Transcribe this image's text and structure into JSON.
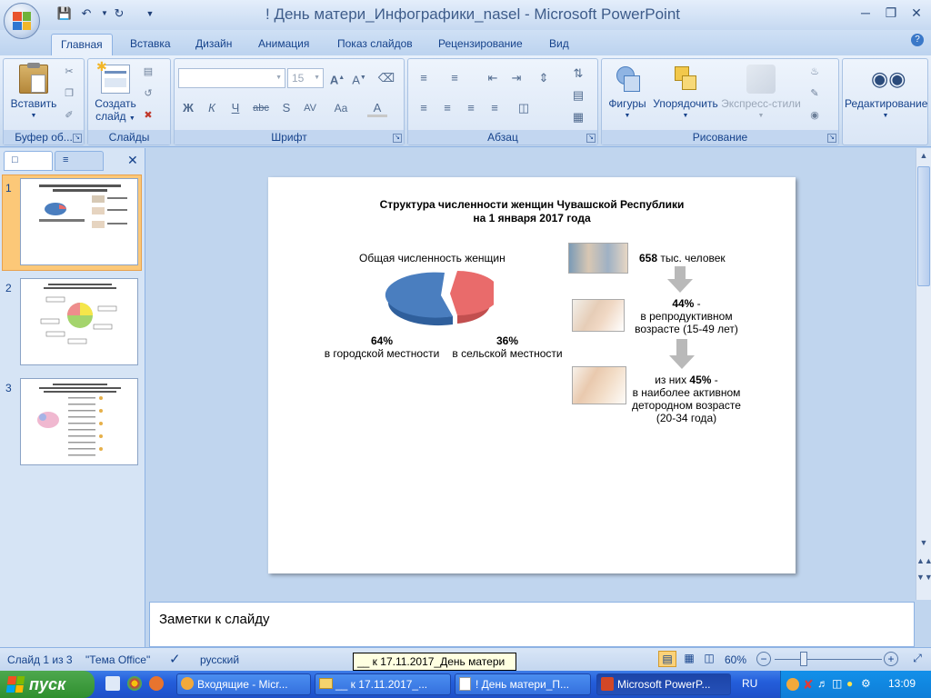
{
  "window": {
    "title": "! День матери_Инфографики_nasel - Microsoft PowerPoint"
  },
  "ribbon": {
    "tabs": [
      "Главная",
      "Вставка",
      "Дизайн",
      "Анимация",
      "Показ слайдов",
      "Рецензирование",
      "Вид"
    ],
    "active_tab": "Главная",
    "groups": {
      "clipboard": {
        "label": "Буфер об...",
        "paste": "Вставить"
      },
      "slides": {
        "label": "Слайды",
        "new_slide_line1": "Создать",
        "new_slide_line2": "слайд"
      },
      "font": {
        "label": "Шрифт",
        "font_size": "15"
      },
      "paragraph": {
        "label": "Абзац"
      },
      "drawing": {
        "label": "Рисование",
        "shapes": "Фигуры",
        "arrange": "Упорядочить",
        "quick_styles": "Экспресс-стили"
      },
      "editing": {
        "label": "Редактирование"
      }
    },
    "font_buttons": [
      "Ж",
      "К",
      "Ч",
      "abc",
      "S",
      "AV",
      "Aa",
      "A"
    ]
  },
  "slides_pane": {
    "numbers": [
      "1",
      "2",
      "3"
    ],
    "selected": "1"
  },
  "slide": {
    "title_line1": "Структура численности женщин Чувашской Республики",
    "title_line2": "на 1 января 2017 года",
    "pie_caption": "Общая численность женщин",
    "urban_pct": "64%",
    "urban_label": "в городской местности",
    "rural_pct": "36%",
    "rural_label": "в сельской местности",
    "total_value": "658",
    "total_unit": " тыс. человек",
    "repro_pct": "44%",
    "repro_dash": " -",
    "repro_line2": "в репродуктивном",
    "repro_line3": "возрасте (15-49 лет)",
    "active_prefix": "из них ",
    "active_pct": "45%",
    "active_dash": " -",
    "active_line2": "в наиболее активном",
    "active_line3": "детородном возрасте",
    "active_line4": "(20-34 года)",
    "colors": {
      "urban": "#4a7ebf",
      "rural": "#e96b6b",
      "arrow": "#b9b9b9"
    }
  },
  "notes": {
    "placeholder": "Заметки к слайду"
  },
  "statusbar": {
    "slide_info": "Слайд 1 из 3",
    "theme": "\"Тема Office\"",
    "language": "русский",
    "zoom": "60%"
  },
  "tooltip": "__ к 17.11.2017_День матери",
  "taskbar": {
    "start": "пуск",
    "buttons": [
      "Входящие - Micr...",
      "__ к 17.11.2017_...",
      "! День матери_П...",
      "Microsoft PowerP..."
    ],
    "lang": "RU",
    "clock": "13:09"
  }
}
